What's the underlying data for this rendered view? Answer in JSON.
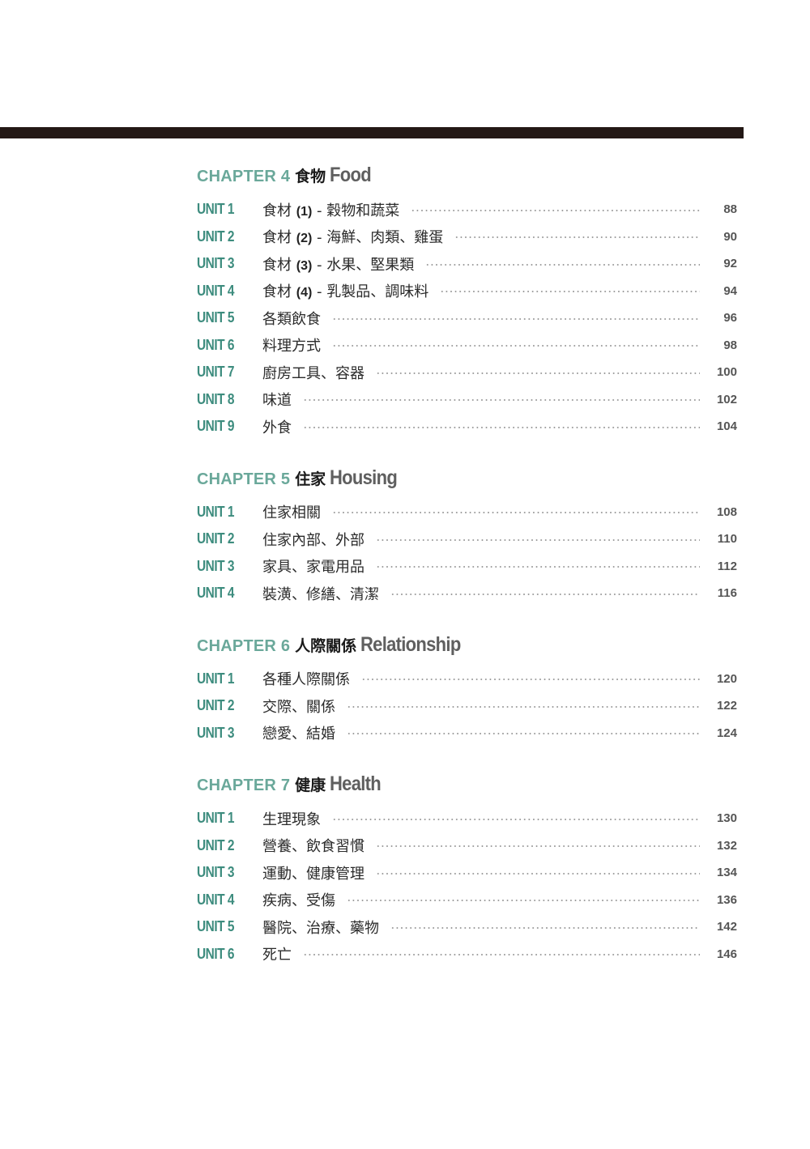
{
  "chapters": [
    {
      "label": "CHAPTER 4",
      "title_zh": "食物",
      "title_en": "Food",
      "units": [
        {
          "label": "UNIT 1",
          "title": "食材 (1) - 穀物和蔬菜",
          "page": "88"
        },
        {
          "label": "UNIT 2",
          "title": "食材 (2) - 海鮮、肉類、雞蛋",
          "page": "90"
        },
        {
          "label": "UNIT 3",
          "title": "食材 (3) - 水果、堅果類",
          "page": "92"
        },
        {
          "label": "UNIT 4",
          "title": "食材 (4) - 乳製品、調味料",
          "page": "94"
        },
        {
          "label": "UNIT 5",
          "title": "各類飲食",
          "page": "96"
        },
        {
          "label": "UNIT 6",
          "title": "料理方式",
          "page": "98"
        },
        {
          "label": "UNIT 7",
          "title": "廚房工具、容器",
          "page": "100"
        },
        {
          "label": "UNIT 8",
          "title": "味道",
          "page": "102"
        },
        {
          "label": "UNIT 9",
          "title": "外食",
          "page": "104"
        }
      ]
    },
    {
      "label": "CHAPTER 5",
      "title_zh": "住家",
      "title_en": "Housing",
      "units": [
        {
          "label": "UNIT 1",
          "title": "住家相關",
          "page": "108"
        },
        {
          "label": "UNIT 2",
          "title": "住家內部、外部",
          "page": "110"
        },
        {
          "label": "UNIT 3",
          "title": "家具、家電用品",
          "page": "112"
        },
        {
          "label": "UNIT 4",
          "title": "裝潢、修繕、清潔",
          "page": "116"
        }
      ]
    },
    {
      "label": "CHAPTER 6",
      "title_zh": "人際關係",
      "title_en": "Relationship",
      "units": [
        {
          "label": "UNIT 1",
          "title": "各種人際關係",
          "page": "120"
        },
        {
          "label": "UNIT 2",
          "title": "交際、關係",
          "page": "122"
        },
        {
          "label": "UNIT 3",
          "title": "戀愛、結婚",
          "page": "124"
        }
      ]
    },
    {
      "label": "CHAPTER 7",
      "title_zh": "健康",
      "title_en": "Health",
      "units": [
        {
          "label": "UNIT 1",
          "title": "生理現象",
          "page": "130"
        },
        {
          "label": "UNIT 2",
          "title": "營養、飲食習慣",
          "page": "132"
        },
        {
          "label": "UNIT 3",
          "title": "運動、健康管理",
          "page": "134"
        },
        {
          "label": "UNIT 4",
          "title": "疾病、受傷",
          "page": "136"
        },
        {
          "label": "UNIT 5",
          "title": "醫院、治療、藥物",
          "page": "142"
        },
        {
          "label": "UNIT 6",
          "title": "死亡",
          "page": "146"
        }
      ]
    }
  ]
}
